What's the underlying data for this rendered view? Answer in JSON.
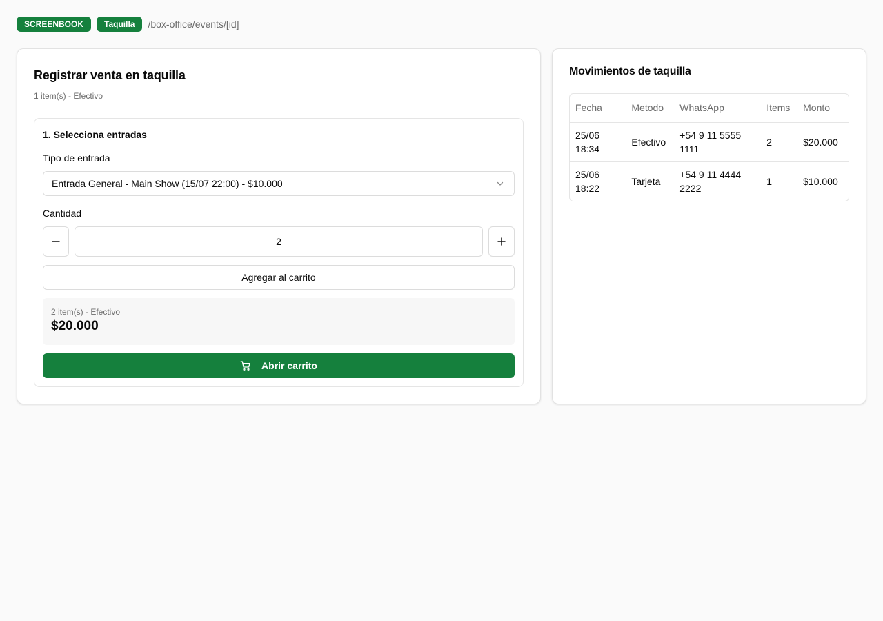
{
  "header": {
    "badge_brand": "SCREENBOOK",
    "badge_section": "Taquilla",
    "route": "/box-office/events/[id]"
  },
  "sale": {
    "title": "Registrar venta en taquilla",
    "subtitle": "1 item(s) - Efectivo",
    "step_title": "1. Selecciona entradas",
    "ticket_type_label": "Tipo de entrada",
    "ticket_type_value": "Entrada General - Main Show (15/07 22:00) - $10.000",
    "quantity_label": "Cantidad",
    "quantity_value": "2",
    "add_to_cart_label": "Agregar al carrito",
    "summary_meta": "2 item(s) - Efectivo",
    "summary_total": "$20.000",
    "open_cart_label": "Abrir carrito"
  },
  "movements": {
    "title": "Movimientos de taquilla",
    "columns": [
      "Fecha",
      "Metodo",
      "WhatsApp",
      "Items",
      "Monto"
    ],
    "rows": [
      {
        "fecha": "25/06 18:34",
        "metodo": "Efectivo",
        "whatsapp": "+54 9 11 5555 1111",
        "items": "2",
        "monto": "$20.000"
      },
      {
        "fecha": "25/06 18:22",
        "metodo": "Tarjeta",
        "whatsapp": "+54 9 11 4444 2222",
        "items": "1",
        "monto": "$10.000"
      }
    ]
  },
  "icons": {
    "select_chevron": "chevron-down-icon",
    "decrement": "minus-icon",
    "increment": "plus-icon",
    "cart": "shopping-cart-icon"
  },
  "colors": {
    "accent": "#15803d",
    "background": "#fafafa",
    "muted_text": "#6b6b6b"
  }
}
